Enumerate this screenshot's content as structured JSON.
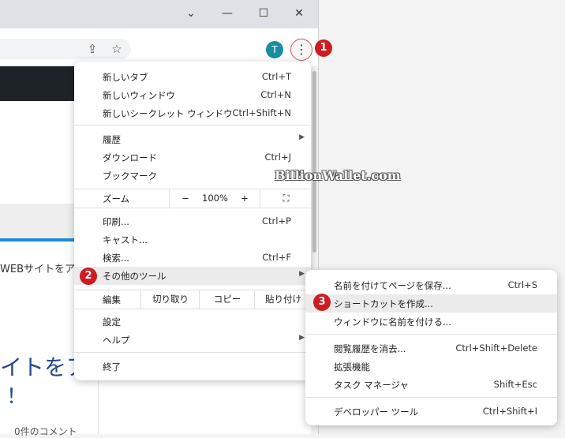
{
  "window": {
    "controls": {
      "collapse": "⌄",
      "minimize": "—",
      "maximize": "☐",
      "close": "✕"
    }
  },
  "toolbar": {
    "avatar_letter": "T",
    "menu_glyph": "⋮",
    "share_glyph": "⇪",
    "star_glyph": "☆"
  },
  "badges": [
    "1",
    "2",
    "3"
  ],
  "page": {
    "text_web": "WEBサイトをア",
    "big_line1": "イトをア",
    "big_line2": "！",
    "comments": "0件のコメント"
  },
  "main_menu": {
    "items": [
      {
        "label": "新しいタブ",
        "shortcut": "Ctrl+T"
      },
      {
        "label": "新しいウィンドウ",
        "shortcut": "Ctrl+N"
      },
      {
        "label": "新しいシークレット ウィンドウ",
        "shortcut": "Ctrl+Shift+N"
      },
      {
        "label": "履歴",
        "shortcut": ""
      },
      {
        "label": "ダウンロード",
        "shortcut": "Ctrl+J"
      },
      {
        "label": "ブックマーク",
        "shortcut": ""
      },
      {
        "label": "印刷...",
        "shortcut": "Ctrl+P"
      },
      {
        "label": "キャスト...",
        "shortcut": ""
      },
      {
        "label": "検索...",
        "shortcut": "Ctrl+F"
      },
      {
        "label": "その他のツール",
        "shortcut": ""
      },
      {
        "label": "設定",
        "shortcut": ""
      },
      {
        "label": "ヘルプ",
        "shortcut": ""
      },
      {
        "label": "終了",
        "shortcut": ""
      }
    ],
    "zoom": {
      "label": "ズーム",
      "minus": "−",
      "value": "100%",
      "plus": "+",
      "fullscreen": "⛶"
    },
    "edit": {
      "label": "編集",
      "cut": "切り取り",
      "copy": "コピー",
      "paste": "貼り付け"
    }
  },
  "sub_menu": {
    "items": [
      {
        "label": "名前を付けてページを保存...",
        "shortcut": "Ctrl+S"
      },
      {
        "label": "ショートカットを作成...",
        "shortcut": ""
      },
      {
        "label": "ウィンドウに名前を付ける...",
        "shortcut": ""
      },
      {
        "label": "閲覧履歴を消去...",
        "shortcut": "Ctrl+Shift+Delete"
      },
      {
        "label": "拡張機能",
        "shortcut": ""
      },
      {
        "label": "タスク マネージャ",
        "shortcut": "Shift+Esc"
      },
      {
        "label": "デベロッパー ツール",
        "shortcut": "Ctrl+Shift+I"
      }
    ]
  },
  "watermark": "BillionWallet.com",
  "colors": {
    "badge": "#cc1d22",
    "avatar": "#1a8ea0",
    "highlight": "#ebebeb"
  }
}
